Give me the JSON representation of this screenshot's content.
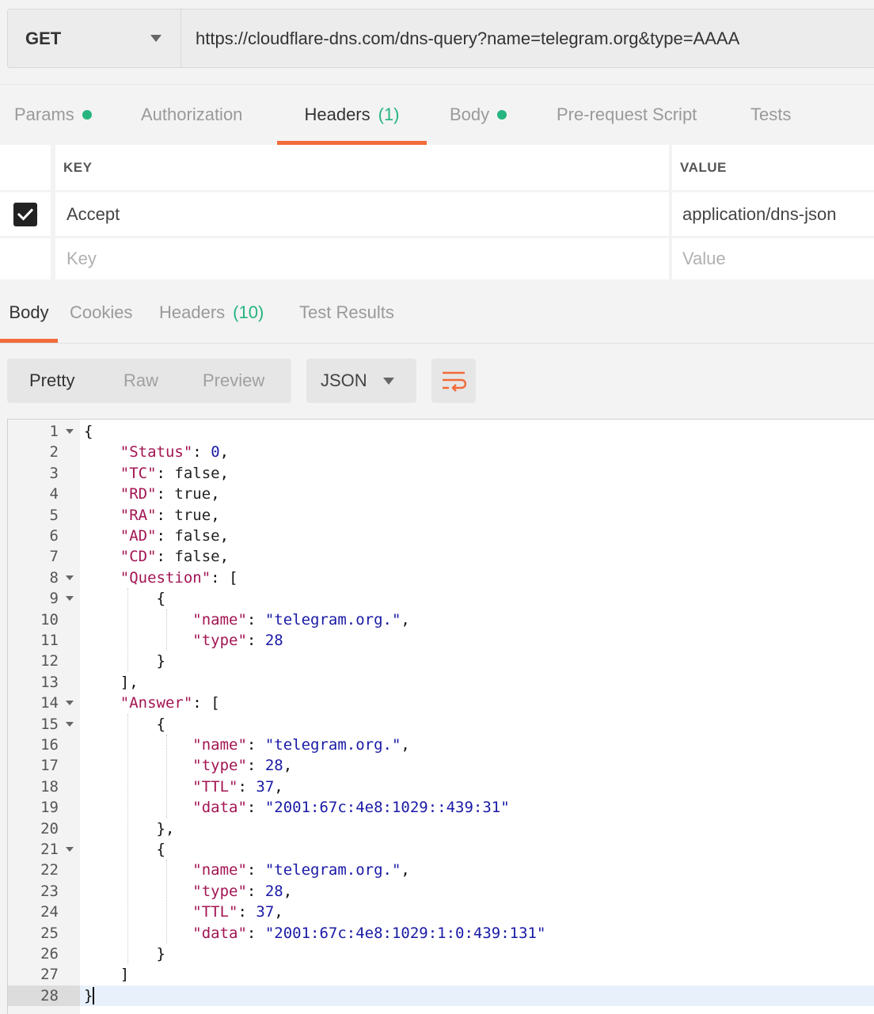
{
  "request": {
    "method": "GET",
    "url": "https://cloudflare-dns.com/dns-query?name=telegram.org&type=AAAA"
  },
  "request_tabs": [
    {
      "label": "Params",
      "dot": true
    },
    {
      "label": "Authorization"
    },
    {
      "label": "Headers",
      "count": "(1)",
      "active": true
    },
    {
      "label": "Body",
      "dot": true
    },
    {
      "label": "Pre-request Script"
    },
    {
      "label": "Tests"
    }
  ],
  "headers_table": {
    "key_header": "KEY",
    "value_header": "VALUE",
    "rows": [
      {
        "checked": true,
        "key": "Accept",
        "value": "application/dns-json"
      }
    ],
    "key_placeholder": "Key",
    "value_placeholder": "Value"
  },
  "response_tabs": [
    {
      "label": "Body",
      "active": true
    },
    {
      "label": "Cookies"
    },
    {
      "label": "Headers",
      "count": "(10)"
    },
    {
      "label": "Test Results"
    }
  ],
  "view_modes": {
    "pretty": "Pretty",
    "raw": "Raw",
    "preview": "Preview",
    "active": "Pretty"
  },
  "format": "JSON",
  "icons": {
    "wrap": "wrap-lines-icon",
    "dropdown": "chevron-down-icon",
    "check": "checkmark-icon"
  },
  "colors": {
    "accent": "#f26b3a",
    "green": "#26b47f"
  },
  "code_lines": [
    "{",
    "    \"Status\": 0,",
    "    \"TC\": false,",
    "    \"RD\": true,",
    "    \"RA\": true,",
    "    \"AD\": false,",
    "    \"CD\": false,",
    "    \"Question\": [",
    "        {",
    "            \"name\": \"telegram.org.\",",
    "            \"type\": 28",
    "        }",
    "    ],",
    "    \"Answer\": [",
    "        {",
    "            \"name\": \"telegram.org.\",",
    "            \"type\": 28,",
    "            \"TTL\": 37,",
    "            \"data\": \"2001:67c:4e8:1029::439:31\"",
    "        },",
    "        {",
    "            \"name\": \"telegram.org.\",",
    "            \"type\": 28,",
    "            \"TTL\": 37,",
    "            \"data\": \"2001:67c:4e8:1029:1:0:439:131\"",
    "        }",
    "    ]",
    "}"
  ],
  "fold_lines": [
    1,
    8,
    9,
    14,
    15,
    21
  ],
  "current_line": 28
}
